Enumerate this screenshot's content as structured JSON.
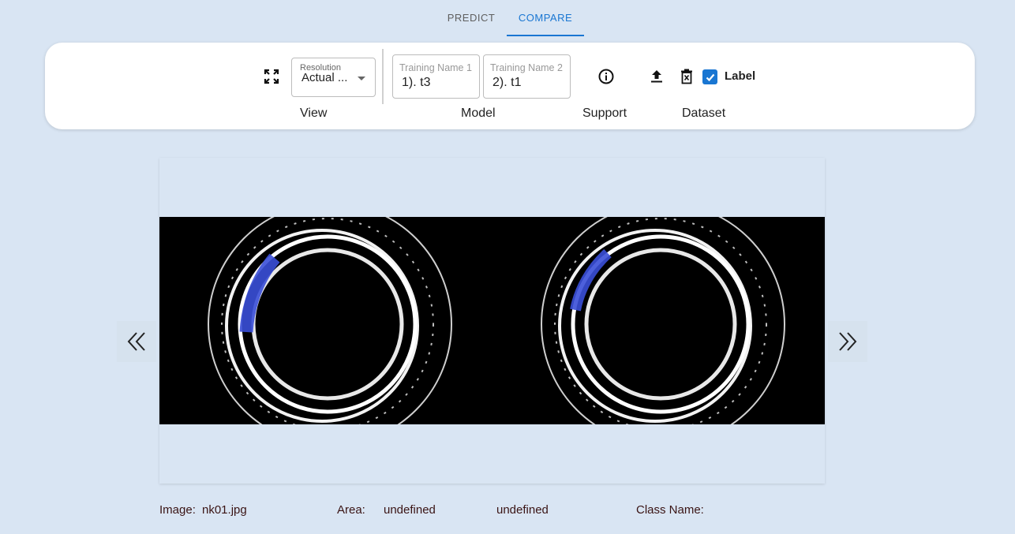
{
  "tabs": [
    {
      "label": "PREDICT",
      "active": false
    },
    {
      "label": "COMPARE",
      "active": true
    }
  ],
  "toolbar": {
    "view": {
      "icon": "fullscreen-icon",
      "resolution_label": "Resolution",
      "resolution_value": "Actual ...",
      "group_label": "View"
    },
    "model": {
      "field1_label": "Training Name 1",
      "field1_value": "1). t3",
      "field2_label": "Training Name 2",
      "field2_value": "2). t1",
      "group_label": "Model"
    },
    "support": {
      "icon": "info-icon",
      "group_label": "Support"
    },
    "dataset": {
      "upload_icon": "upload-icon",
      "delete_icon": "delete-icon",
      "label_checked": true,
      "label_text": "Label",
      "group_label": "Dataset"
    }
  },
  "navigation": {
    "prev_icon": "double-chevron-left-icon",
    "next_icon": "double-chevron-right-icon"
  },
  "info": {
    "image_label": "Image:",
    "image_value": "nk01.jpg",
    "area_label": "Area:",
    "area_value1": "undefined",
    "area_value2": "undefined",
    "class_label": "Class Name:",
    "class_value": ""
  },
  "colors": {
    "accent": "#1976d2",
    "background": "#d9e5f3",
    "highlight": "#3a4fd8"
  }
}
